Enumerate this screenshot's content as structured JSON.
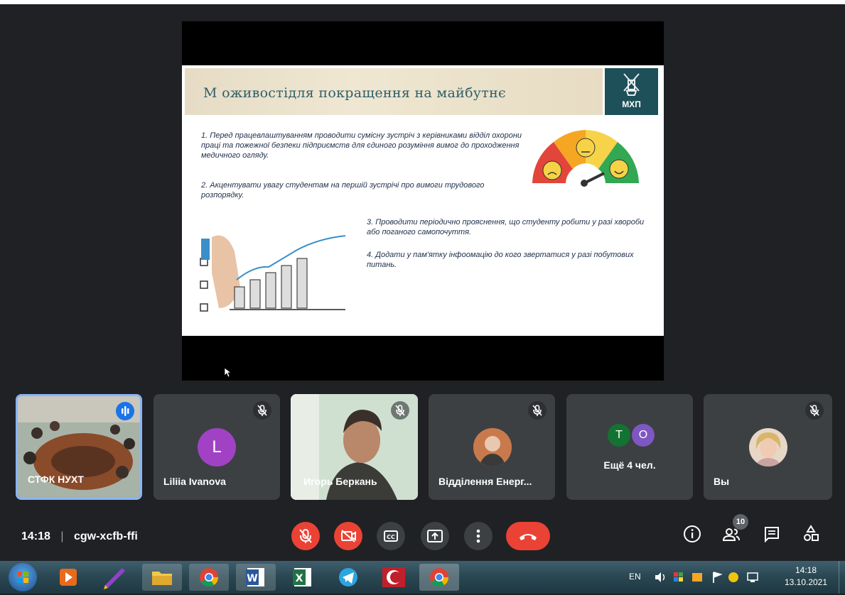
{
  "slide": {
    "title": "М оживостідля покращення на майбутнє",
    "logo_text": "МХП",
    "items": [
      "1.  Перед працевлаштуванням проводити сумісну зустріч з керівниками відділ охорони праці та пожежної безпеки підприємств для єдиного розуміння вимог до проходження медичного огляду.",
      "2.  Акцентувати увагу студентам на першій зустрічі про вимоги трудового розпорядку.",
      "3.  Проводити періодично прояснення, що студенту робити у разі хвороби або поганого самопочуття.",
      "4. Додати у пам'ятку інфоомацію до кого звертатися у разі побутових питань."
    ]
  },
  "participants": [
    {
      "name": "СТФК НУХТ",
      "speaking": true
    },
    {
      "name": "Liliia Ivanova",
      "initial": "L",
      "avatar_color": "#a142c4",
      "muted": true
    },
    {
      "name": "Игорь Беркань",
      "muted": true
    },
    {
      "name": "Відділення Енерг...",
      "muted": true
    },
    {
      "name": "Ещё 4 чел.",
      "avatars": [
        {
          "letter": "T",
          "color": "#137333"
        },
        {
          "letter": "O",
          "color": "#7e57c2"
        }
      ]
    },
    {
      "name": "Вы",
      "muted": true
    }
  ],
  "meeting": {
    "time": "14:18",
    "separator": "|",
    "code": "cgw-xcfb-ffi",
    "participant_count": "10"
  },
  "controls": {
    "mic": "mic-off-icon",
    "camera": "camera-off-icon",
    "captions": "captions-icon",
    "present": "present-screen-icon",
    "more": "more-options-icon",
    "leave": "hang-up-icon"
  },
  "taskbar": {
    "lang": "EN",
    "clock_time": "14:18",
    "clock_date": "13.10.2021"
  },
  "colors": {
    "danger": "#ea4335",
    "accent": "#8ab4f8",
    "tile": "#3c4043",
    "background": "#202124"
  }
}
